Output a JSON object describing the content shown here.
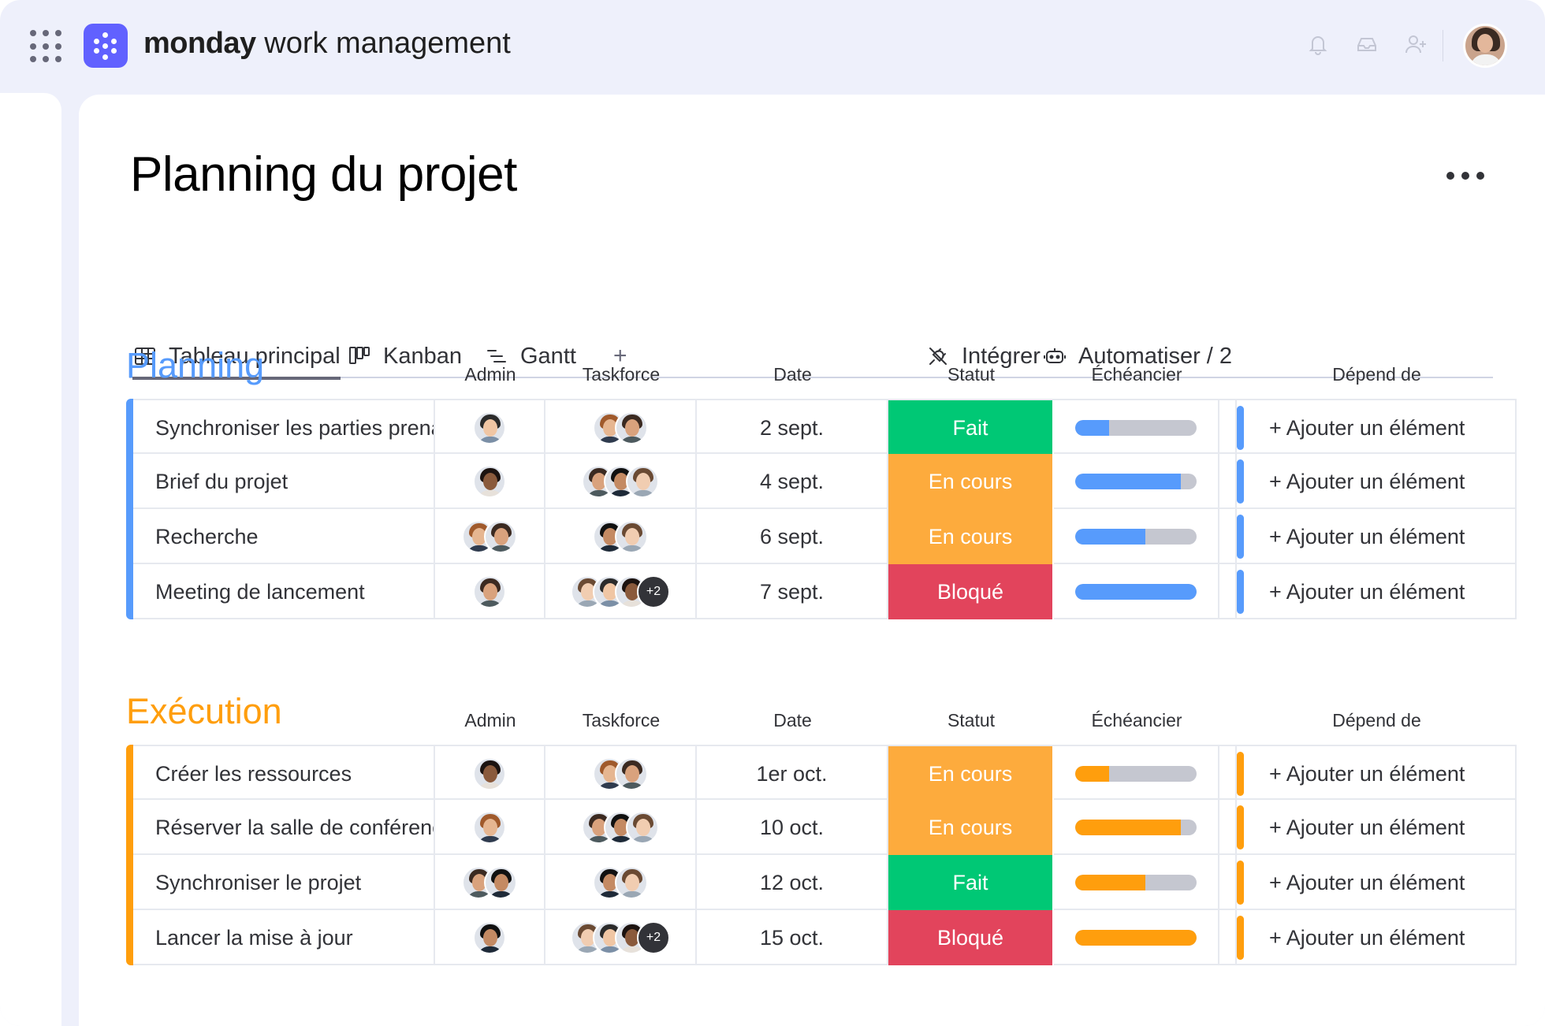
{
  "app": {
    "brand_bold": "monday",
    "brand_rest": "work management"
  },
  "page": {
    "title": "Planning du projet"
  },
  "tabs": [
    {
      "label": "Tableau principal",
      "icon": "table-icon",
      "active": true
    },
    {
      "label": "Kanban",
      "icon": "kanban-icon",
      "active": false
    },
    {
      "label": "Gantt",
      "icon": "gantt-icon",
      "active": false
    }
  ],
  "tab_add": "+",
  "actions": {
    "integrate": "Intégrer",
    "automate": "Automatiser / 2"
  },
  "columns": {
    "admin": "Admin",
    "taskforce": "Taskforce",
    "date": "Date",
    "status": "Statut",
    "timeline": "Échéancier",
    "depends": "Dépend de"
  },
  "colors": {
    "planning": "#579bfc",
    "execution": "#ff9e0d",
    "done": "#00c875",
    "working": "#fdab3d",
    "stuck": "#e2445c",
    "track": "#c5c7d0"
  },
  "groups": [
    {
      "title": "Planning",
      "color": "#579bfc",
      "rows": [
        {
          "name": "Synchroniser les parties prenantes",
          "admin": 1,
          "taskforce": 2,
          "extra": "",
          "date": "2 sept.",
          "status": "Fait",
          "status_color": "#00c875",
          "progress": 0.28,
          "dep": "+ Ajouter un élément"
        },
        {
          "name": "Brief du projet",
          "admin": 1,
          "taskforce": 3,
          "extra": "",
          "date": "4 sept.",
          "status": "En cours",
          "status_color": "#fdab3d",
          "progress": 0.87,
          "dep": "+ Ajouter un élément"
        },
        {
          "name": "Recherche",
          "admin": 2,
          "taskforce": 2,
          "extra": "",
          "date": "6 sept.",
          "status": "En cours",
          "status_color": "#fdab3d",
          "progress": 0.58,
          "dep": "+ Ajouter un élément"
        },
        {
          "name": "Meeting de lancement",
          "admin": 1,
          "taskforce": 3,
          "extra": "+2",
          "date": "7 sept.",
          "status": "Bloqué",
          "status_color": "#e2445c",
          "progress": 1.0,
          "dep": "+ Ajouter un élément"
        }
      ]
    },
    {
      "title": "Exécution",
      "color": "#ff9e0d",
      "rows": [
        {
          "name": "Créer les ressources",
          "admin": 1,
          "taskforce": 2,
          "extra": "",
          "date": "1er oct.",
          "status": "En cours",
          "status_color": "#fdab3d",
          "progress": 0.28,
          "dep": "+ Ajouter un élément"
        },
        {
          "name": "Réserver la salle de conférence",
          "admin": 1,
          "taskforce": 3,
          "extra": "",
          "date": "10 oct.",
          "status": "En cours",
          "status_color": "#fdab3d",
          "progress": 0.87,
          "dep": "+ Ajouter un élément"
        },
        {
          "name": "Synchroniser le projet",
          "admin": 2,
          "taskforce": 2,
          "extra": "",
          "date": "12 oct.",
          "status": "Fait",
          "status_color": "#00c875",
          "progress": 0.58,
          "dep": "+ Ajouter un élément"
        },
        {
          "name": "Lancer la mise à jour",
          "admin": 1,
          "taskforce": 3,
          "extra": "+2",
          "date": "15 oct.",
          "status": "Bloqué",
          "status_color": "#e2445c",
          "progress": 1.0,
          "dep": "+ Ajouter un élément"
        }
      ]
    }
  ]
}
